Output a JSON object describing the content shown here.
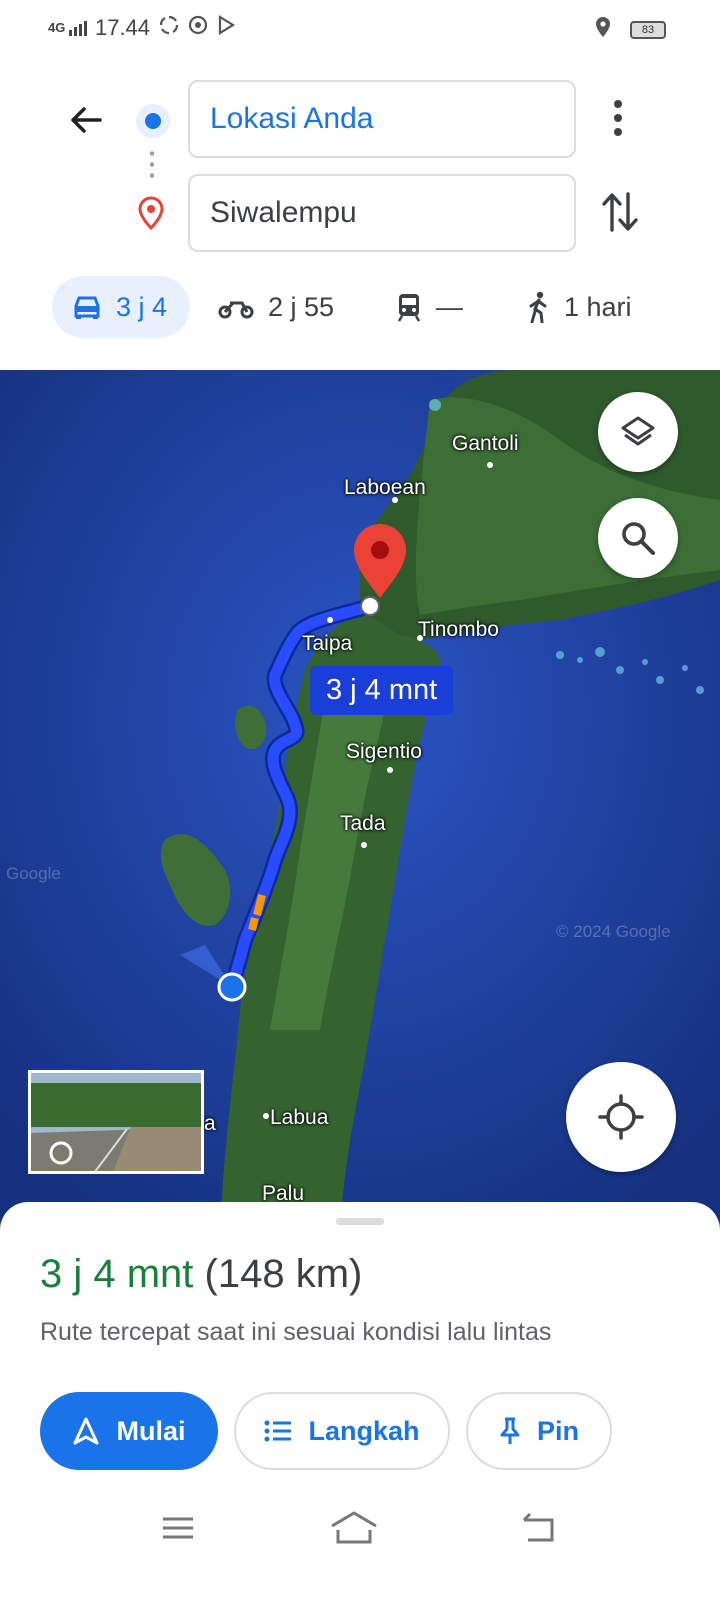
{
  "status_bar": {
    "network": "4G",
    "time": "17.44",
    "battery": "83"
  },
  "directions": {
    "origin": "Lokasi Anda",
    "destination": "Siwalempu"
  },
  "modes": [
    {
      "name": "car",
      "label": "3 j 4",
      "active": true
    },
    {
      "name": "motorcycle",
      "label": "2 j 55",
      "active": false
    },
    {
      "name": "transit",
      "label": "—",
      "active": false
    },
    {
      "name": "walk",
      "label": "1 hari",
      "active": false
    }
  ],
  "map": {
    "labels": {
      "gantoli": "Gantoli",
      "laboean": "Laboean",
      "taipa": "Taipa",
      "tinombo": "Tinombo",
      "sigentio": "Sigentio",
      "tada": "Tada",
      "labua": "Labua",
      "palu": "Palu",
      "a": "a"
    },
    "route_badge": "3 j 4 mnt",
    "watermark": "© 2024 Google",
    "watermark_left": "Google"
  },
  "sheet": {
    "duration": "3 j 4 mnt",
    "distance": "(148 km)",
    "description": "Rute tercepat saat ini sesuai kondisi lalu lintas",
    "start_label": "Mulai",
    "steps_label": "Langkah",
    "pin_label": "Pin"
  },
  "colors": {
    "accent": "#1a73e8",
    "route": "#1a3fd8",
    "duration_green": "#188038",
    "destination_pin": "#ea4335"
  }
}
